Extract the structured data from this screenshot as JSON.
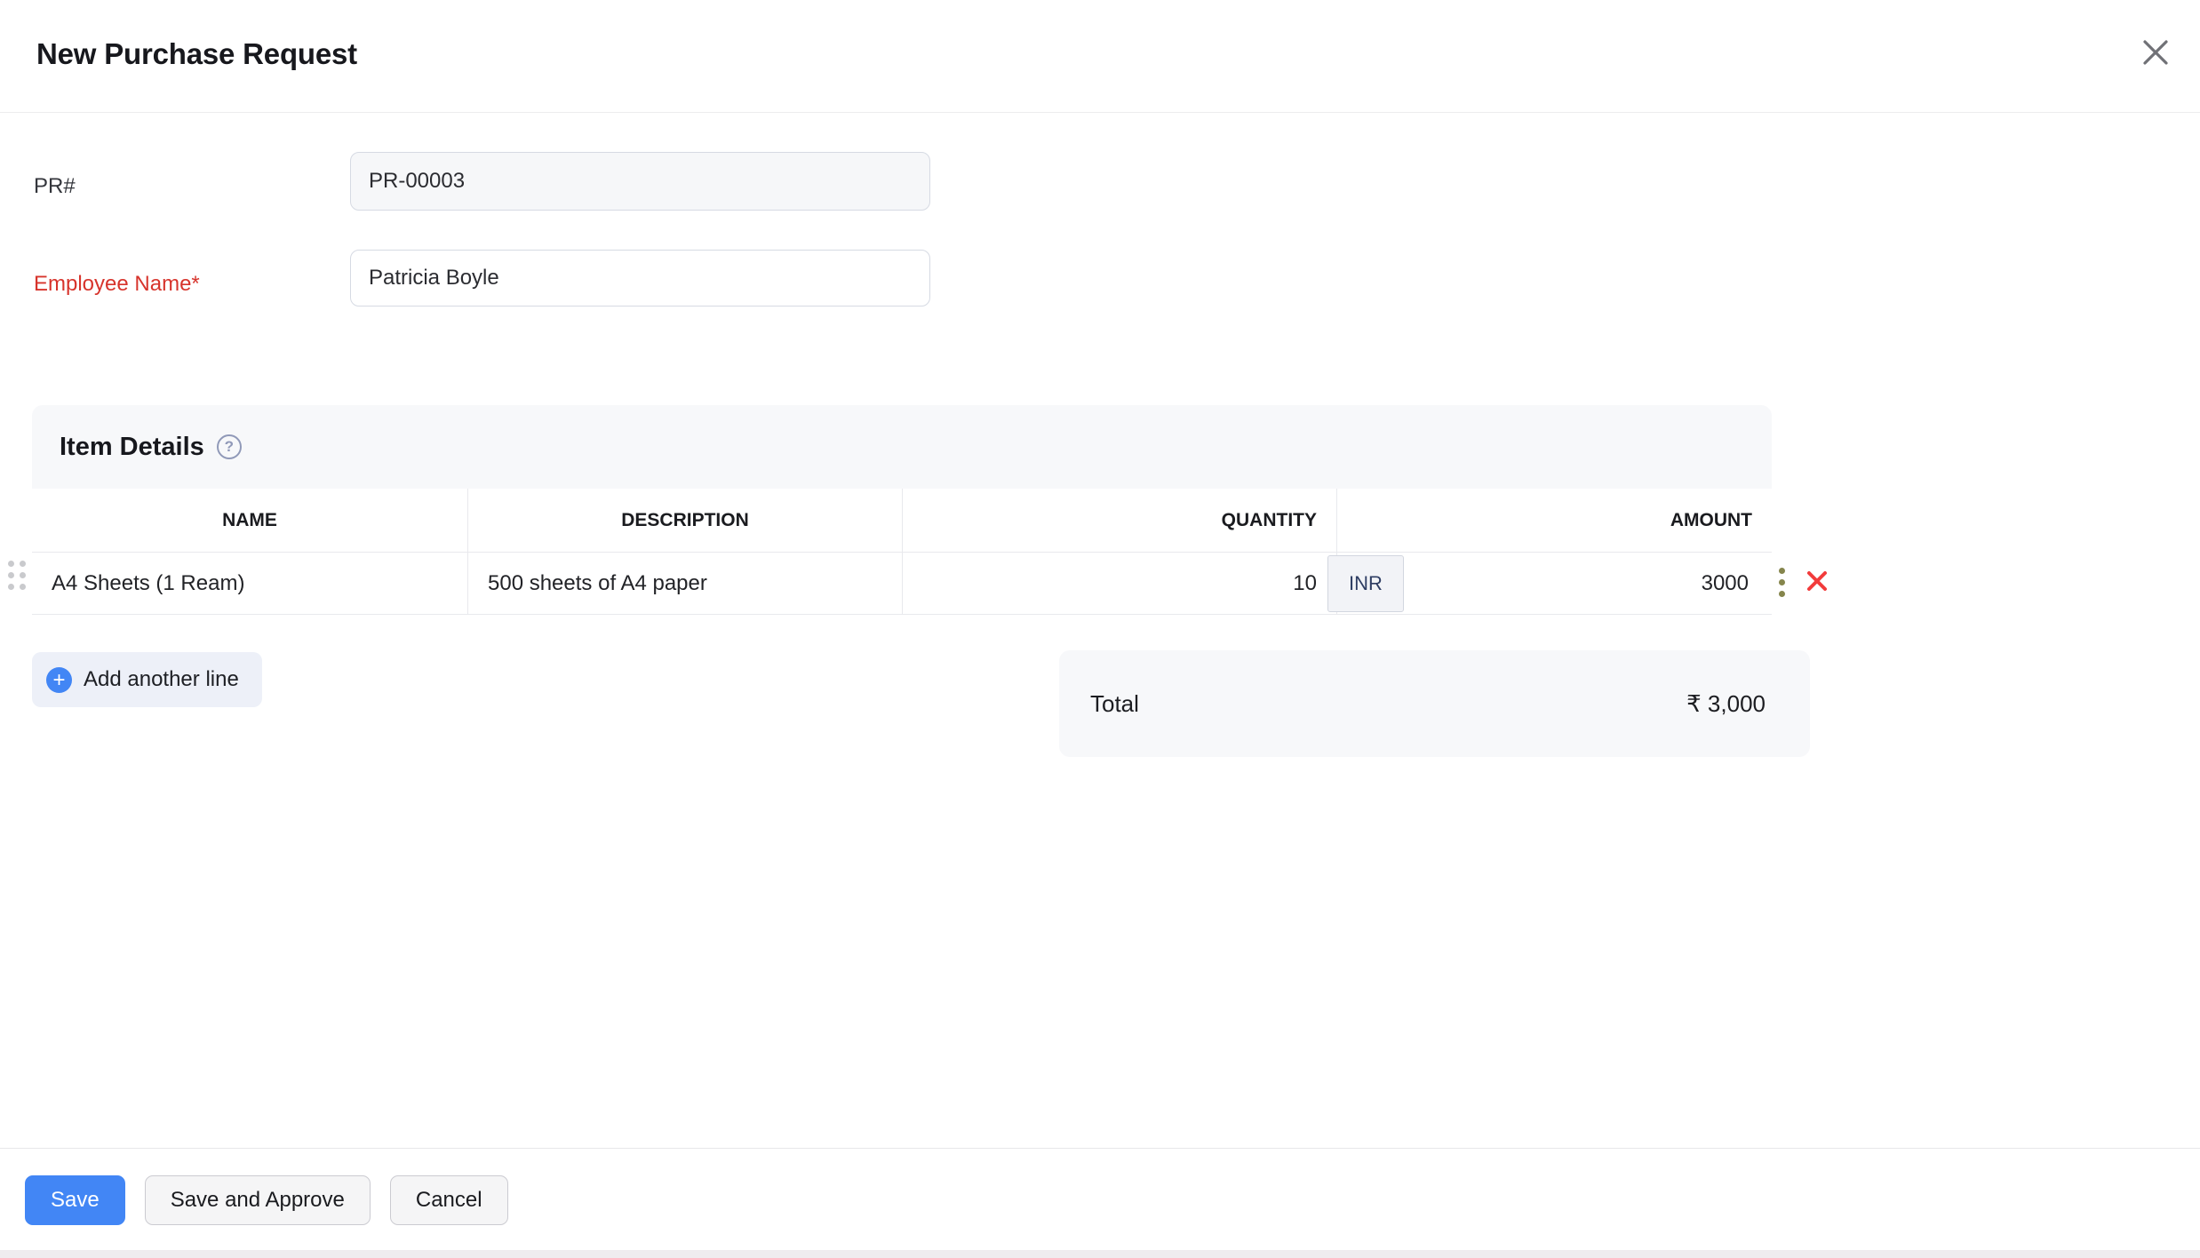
{
  "modal": {
    "title": "New Purchase Request"
  },
  "form": {
    "pr_label": "PR#",
    "pr_value": "PR-00003",
    "employee_label": "Employee Name*",
    "employee_value": "Patricia Boyle"
  },
  "item_details": {
    "title": "Item Details",
    "help_glyph": "?",
    "columns": [
      "NAME",
      "DESCRIPTION",
      "QUANTITY",
      "AMOUNT"
    ],
    "rows": [
      {
        "name": "A4 Sheets (1 Ream)",
        "description": "500 sheets of A4 paper",
        "quantity": "10",
        "currency": "INR",
        "amount": "3000"
      }
    ],
    "add_line_label": "Add another line",
    "plus_glyph": "+",
    "total_label": "Total",
    "total_value": "₹ 3,000"
  },
  "footer": {
    "save_label": "Save",
    "save_approve_label": "Save and Approve",
    "cancel_label": "Cancel"
  },
  "colors": {
    "primary_blue": "#4286f5",
    "required_red": "#d7342c",
    "delete_red": "#f23b3b",
    "menu_olive": "#85854c",
    "panel_bg": "#f7f8fa",
    "border_gray": "#e8e9ed"
  }
}
